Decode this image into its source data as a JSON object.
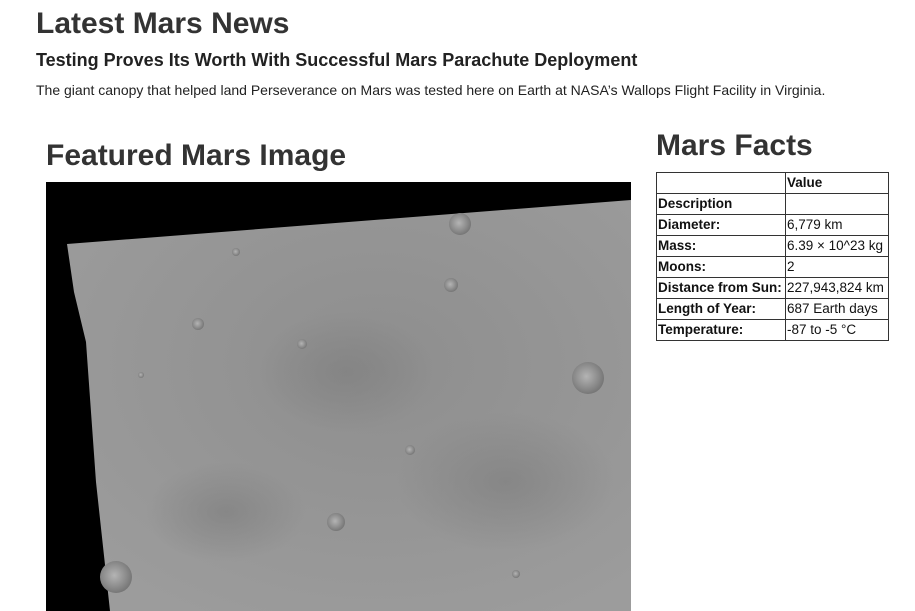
{
  "news": {
    "heading": "Latest Mars News",
    "title": "Testing Proves Its Worth With Successful Mars Parachute Deployment",
    "teaser": "The giant canopy that helped land Perseverance on Mars was tested here on Earth at NASA’s Wallops Flight Facility in Virginia."
  },
  "featured": {
    "heading": "Featured Mars Image"
  },
  "facts": {
    "heading": "Mars Facts",
    "header": {
      "label": "",
      "value": "Value"
    },
    "description_label": "Description",
    "rows": [
      {
        "label": "Diameter:",
        "value": "6,779 km"
      },
      {
        "label": "Mass:",
        "value": "6.39 × 10^23 kg"
      },
      {
        "label": "Moons:",
        "value": "2"
      },
      {
        "label": "Distance from Sun:",
        "value": "227,943,824 km"
      },
      {
        "label": "Length of Year:",
        "value": "687 Earth days"
      },
      {
        "label": "Temperature:",
        "value": "-87 to -5 °C"
      }
    ]
  }
}
